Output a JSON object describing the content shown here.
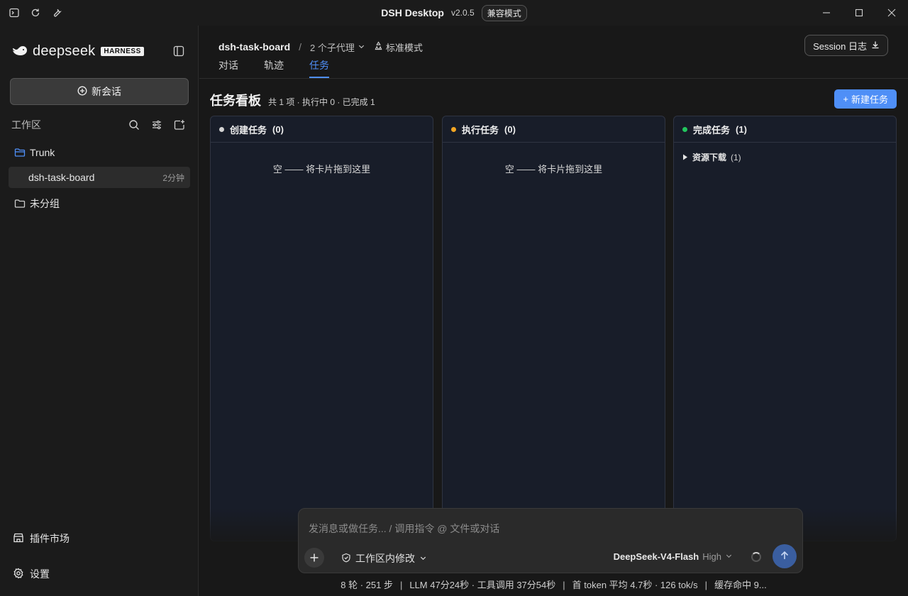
{
  "titlebar": {
    "title": "DSH Desktop",
    "version": "v2.0.5",
    "compat_badge": "兼容模式"
  },
  "sidebar": {
    "logo_text": "deepseek",
    "logo_badge": "HARNESS",
    "new_chat_label": "新会话",
    "workspace_label": "工作区",
    "tree": [
      {
        "label": "Trunk",
        "type": "folder-open"
      },
      {
        "label": "dsh-task-board",
        "meta": "2分钟",
        "active": true
      },
      {
        "label": "未分组",
        "type": "folder"
      }
    ],
    "plugin_market_label": "插件市场",
    "settings_label": "设置"
  },
  "header": {
    "project": "dsh-task-board",
    "separator": "/",
    "subagents": "2 个子代理",
    "mode": "标准模式",
    "session_log": "Session 日志",
    "tabs": [
      {
        "label": "对话",
        "active": false
      },
      {
        "label": "轨迹",
        "active": false
      },
      {
        "label": "任务",
        "active": true
      }
    ]
  },
  "board": {
    "title": "任务看板",
    "summary": "共 1 项 · 执行中 0 · 已完成 1",
    "new_task": "新建任务",
    "columns": [
      {
        "name": "创建任务",
        "count": "(0)",
        "dot_color": "#d4d4d4",
        "empty": "空 —— 将卡片拖到这里"
      },
      {
        "name": "执行任务",
        "count": "(0)",
        "dot_color": "#f5a623",
        "empty": "空 —— 将卡片拖到这里"
      },
      {
        "name": "完成任务",
        "count": "(1)",
        "dot_color": "#22c55e",
        "group": {
          "name": "资源下载",
          "count": "(1)"
        }
      }
    ]
  },
  "composer": {
    "placeholder": "发消息或做任务... / 调用指令 @ 文件或对话",
    "permission": "工作区内修改",
    "model": "DeepSeek-V4-Flash",
    "model_level": "High"
  },
  "status": {
    "rounds": "8 轮 · 251 步",
    "llm": "LLM 47分24秒 · 工具调用 37分54秒",
    "first_token": "首 token 平均 4.7秒 · 126 tok/s",
    "cache": "缓存命中 9..."
  },
  "colors": {
    "accent": "#4f8ff7",
    "column_bg": "#181d29"
  }
}
